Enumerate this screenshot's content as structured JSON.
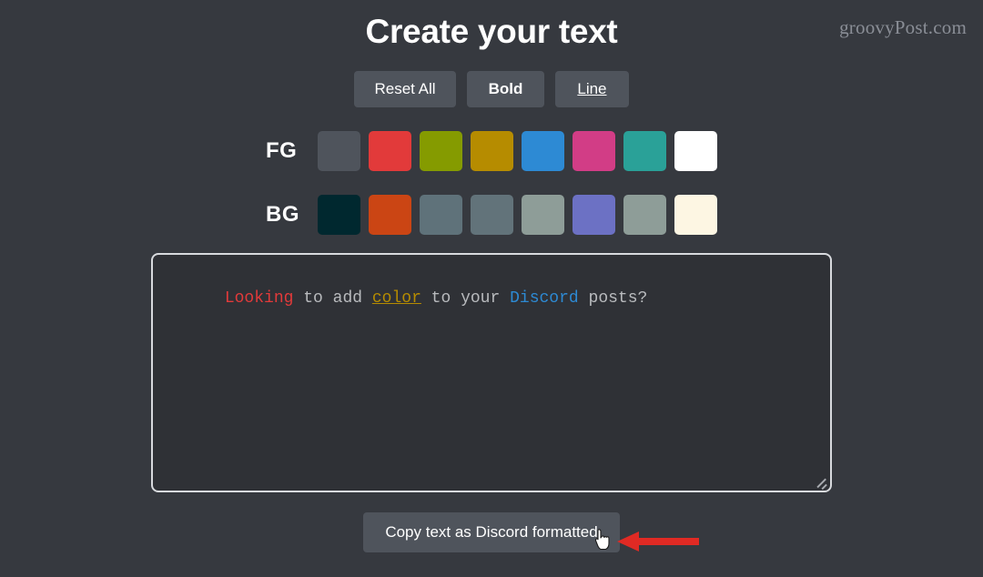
{
  "page": {
    "background_color": "#36393f",
    "title": "Create your text",
    "watermark": "groovyPost.com"
  },
  "toolbar": {
    "buttons": [
      {
        "label": "Reset All",
        "style": "normal",
        "name": "reset-all-button"
      },
      {
        "label": "Bold",
        "style": "bold",
        "name": "bold-button"
      },
      {
        "label": "Line",
        "style": "underline",
        "name": "line-button"
      }
    ],
    "button_color": "#4f545c"
  },
  "foreground": {
    "label": "FG",
    "swatches": [
      {
        "name": "fg-swatch-gray",
        "color": "#4f545c"
      },
      {
        "name": "fg-swatch-red",
        "color": "#e23a3a"
      },
      {
        "name": "fg-swatch-olive",
        "color": "#859b00"
      },
      {
        "name": "fg-swatch-gold",
        "color": "#b68c00"
      },
      {
        "name": "fg-swatch-blue",
        "color": "#2d8ad4"
      },
      {
        "name": "fg-swatch-pink",
        "color": "#d23d86"
      },
      {
        "name": "fg-swatch-teal",
        "color": "#2aa198"
      },
      {
        "name": "fg-swatch-white",
        "color": "#ffffff"
      }
    ]
  },
  "background": {
    "label": "BG",
    "swatches": [
      {
        "name": "bg-swatch-dark-teal",
        "color": "#00282f"
      },
      {
        "name": "bg-swatch-orange",
        "color": "#cb4514"
      },
      {
        "name": "bg-swatch-slate",
        "color": "#5f727a"
      },
      {
        "name": "bg-swatch-slate-2",
        "color": "#62737a"
      },
      {
        "name": "bg-swatch-sage",
        "color": "#8e9d98"
      },
      {
        "name": "bg-swatch-purple",
        "color": "#6c71c4"
      },
      {
        "name": "bg-swatch-sage-2",
        "color": "#8e9d98"
      },
      {
        "name": "bg-swatch-cream",
        "color": "#fdf6e3"
      }
    ]
  },
  "editor": {
    "background_color": "#2f3136",
    "border_color": "#d8dade",
    "default_text_color": "#b9bbbe",
    "segments": [
      {
        "text": "Looking",
        "color": "#e23a3a",
        "underline": false
      },
      {
        "text": " to add ",
        "color": "#b9bbbe",
        "underline": false
      },
      {
        "text": "color",
        "color": "#b68c00",
        "underline": true
      },
      {
        "text": " to your ",
        "color": "#b9bbbe",
        "underline": false
      },
      {
        "text": "Discord",
        "color": "#2d8ad4",
        "underline": false
      },
      {
        "text": " posts?",
        "color": "#b9bbbe",
        "underline": false
      }
    ]
  },
  "copy": {
    "label": "Copy text as Discord formatted"
  },
  "annotation": {
    "arrow_color": "#e02a24",
    "arrow_direction": "left",
    "cursor": "pointer-hand"
  }
}
